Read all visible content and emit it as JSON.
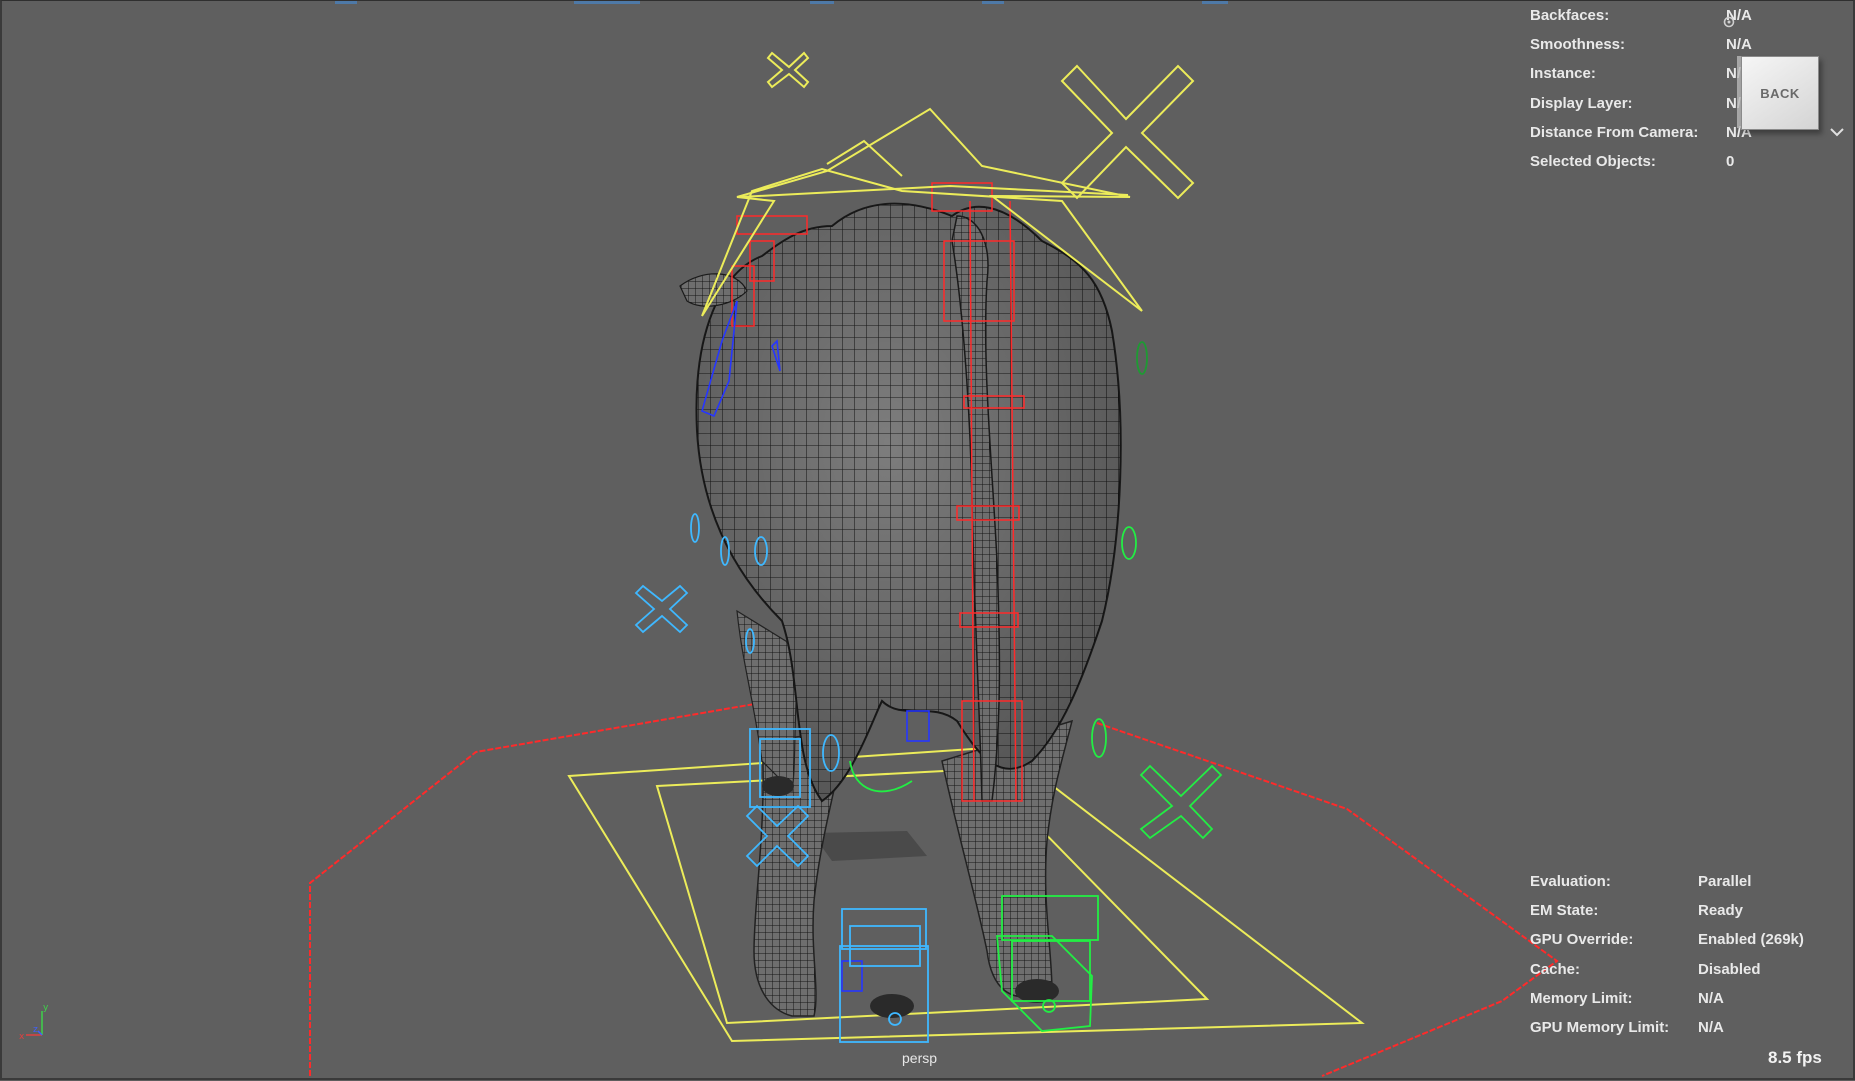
{
  "viewport": {
    "camera_name": "persp",
    "fps": "8.5 fps",
    "back_label": "BACK"
  },
  "hud_top": [
    {
      "label": "Backfaces:",
      "value": "N/A"
    },
    {
      "label": "Smoothness:",
      "value": "N/A"
    },
    {
      "label": "Instance:",
      "value": "N/A"
    },
    {
      "label": "Display Layer:",
      "value": "N/A"
    },
    {
      "label": "Distance From Camera:",
      "value": "N/A"
    },
    {
      "label": "Selected Objects:",
      "value": "0"
    }
  ],
  "hud_bottom": [
    {
      "label": "Evaluation:",
      "value": "Parallel"
    },
    {
      "label": "EM State:",
      "value": "Ready"
    },
    {
      "label": "GPU Override:",
      "value": "Enabled (269k)"
    },
    {
      "label": "Cache:",
      "value": "Disabled"
    },
    {
      "label": "Memory Limit:",
      "value": "N/A"
    },
    {
      "label": "GPU Memory Limit:",
      "value": "N/A"
    }
  ],
  "axis": {
    "x": "x",
    "y": "y",
    "z": "z"
  },
  "icons": [
    "viewcube-back-icon",
    "viewcube-menu-chevron-icon",
    "viewcube-home-icon",
    "axis-gizmo-icon"
  ],
  "colors": {
    "background": "#5f5f5f",
    "rig_yellow": "#f0f060",
    "rig_red": "#ff2a2a",
    "rig_cyan": "#3fb8ff",
    "rig_green": "#22ee44",
    "rig_blue": "#2233ee",
    "mesh": "#8a8a8a"
  }
}
